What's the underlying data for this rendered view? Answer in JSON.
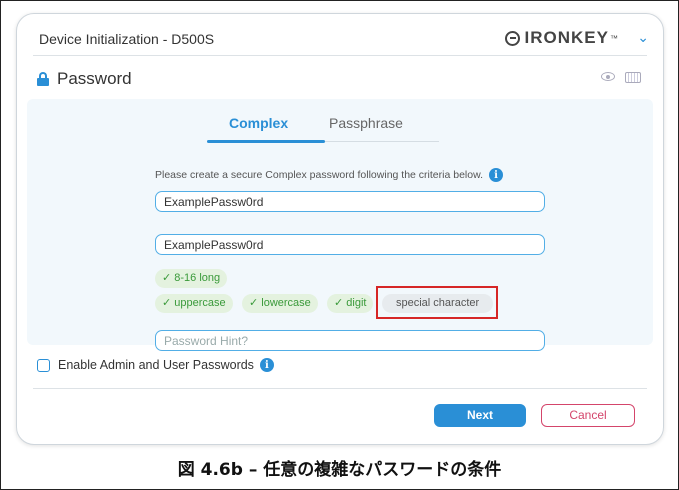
{
  "window": {
    "title": "Device Initialization - D500S",
    "brand": "IRONKEY",
    "brand_tm": "™"
  },
  "section": {
    "title": "Password"
  },
  "tabs": [
    {
      "label": "Complex",
      "active": true
    },
    {
      "label": "Passphrase",
      "active": false
    }
  ],
  "form": {
    "instructions": "Please create a secure Complex password following the criteria below.",
    "password_value": "ExamplePassw0rd",
    "confirm_value": "ExamplePassw0rd",
    "hint_placeholder": "Password Hint?"
  },
  "criteria": [
    {
      "label": "✓ 8-16 long",
      "met": true
    },
    {
      "label": "✓ uppercase",
      "met": true
    },
    {
      "label": "✓ lowercase",
      "met": true
    },
    {
      "label": "✓ digit",
      "met": true
    },
    {
      "label": "special character",
      "met": false
    }
  ],
  "options": {
    "admin_user_label": "Enable Admin and User Passwords",
    "admin_user_checked": false
  },
  "buttons": {
    "next": "Next",
    "cancel": "Cancel"
  },
  "caption": "図 4.6b – 任意の複雑なパスワードの条件",
  "colors": {
    "accent": "#2a8fd6",
    "criteria_met": "#3a9a3a",
    "cancel": "#d4456b",
    "highlight": "#d62626"
  }
}
